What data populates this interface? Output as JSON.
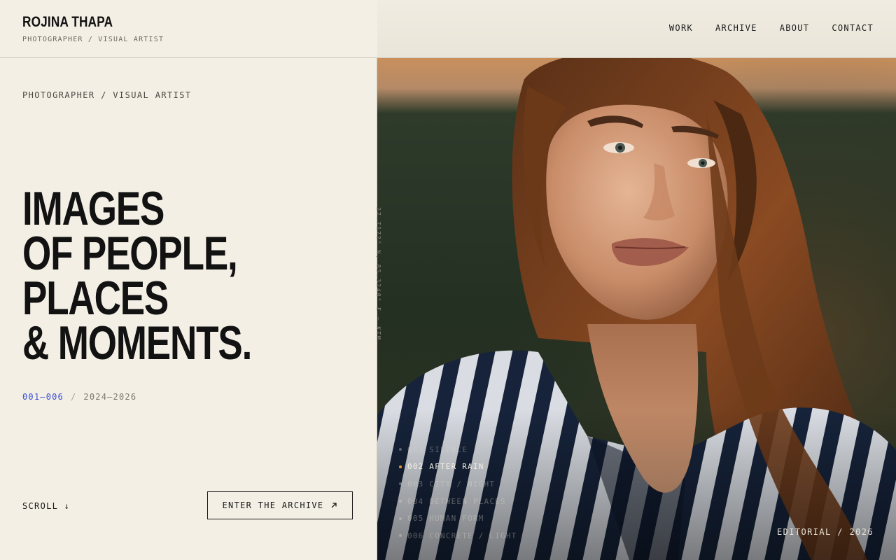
{
  "brand": {
    "name": "ROJINA THAPA",
    "tagline": "PHOTOGRAPHER / VISUAL ARTIST"
  },
  "nav": {
    "items": [
      {
        "label": "WORK"
      },
      {
        "label": "ARCHIVE"
      },
      {
        "label": "ABOUT"
      },
      {
        "label": "CONTACT"
      }
    ]
  },
  "hero": {
    "eyebrow": "PHOTOGRAPHER / VISUAL ARTIST",
    "headline": [
      "IMAGES",
      "OF PEOPLE,",
      "PLACES",
      "& MOMENTS."
    ],
    "index_range": "001—006",
    "index_separator": "/",
    "years": "2024—2026",
    "scroll_label": "SCROLL ↓",
    "cta_label": "ENTER THE ARCHIVE",
    "cta_icon": "arrow-up-right-icon",
    "vertical_meta": "27.7172° N, 85.3240° E — KTM"
  },
  "series": {
    "items": [
      {
        "label": "001 SILENCE",
        "active": false
      },
      {
        "label": "002 AFTER RAIN",
        "active": true
      },
      {
        "label": "003 CITY / NIGHT",
        "active": false
      },
      {
        "label": "004 BETWEEN PLACES",
        "active": false
      },
      {
        "label": "005 HUMAN FORM",
        "active": false
      },
      {
        "label": "006 CONCRETE / LIGHT",
        "active": false
      }
    ]
  },
  "photo": {
    "caption": "EDITORIAL / 2026"
  },
  "colors": {
    "background": "#f3efe4",
    "ink": "#141414",
    "accent_blue": "#3d4fd6",
    "accent_orange": "#e59a3c"
  }
}
